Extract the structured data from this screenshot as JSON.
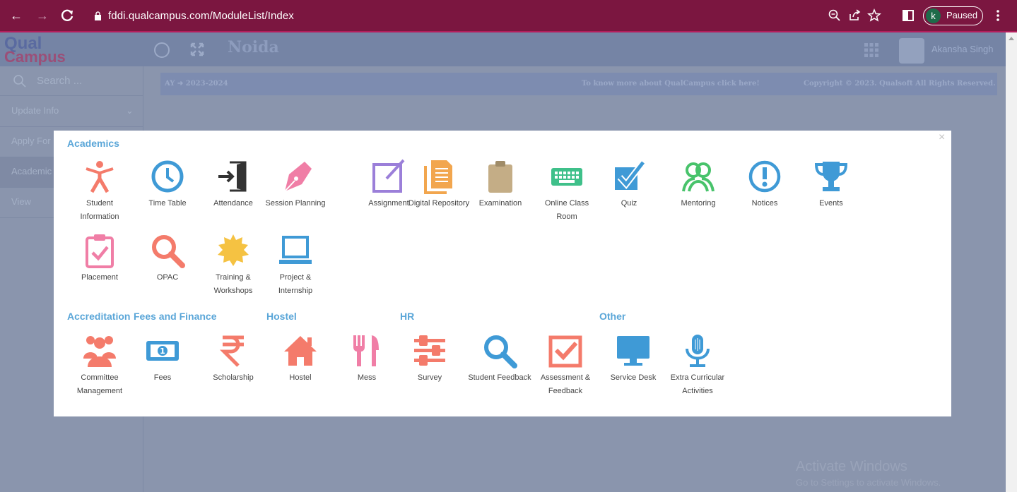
{
  "browser": {
    "url": "fddi.qualcampus.com/ModuleList/Index",
    "profile_initial": "k",
    "profile_status": "Paused"
  },
  "app": {
    "logo_top": "Qual",
    "logo_bottom": "Campus",
    "location": "Noida",
    "user_name": "Akansha Singh",
    "search_placeholder": "Search ...",
    "sidebar": [
      "Update Info",
      "Apply For",
      "Academic",
      "View"
    ],
    "ay_text": "AY ➜ 2023-2024",
    "know_more": "To know more about QualCampus click here!",
    "copyright": "Copyright © 2023. Qualsoft All Rights Reserved."
  },
  "watermark": {
    "title": "Activate Windows",
    "subtitle": "Go to Settings to activate Windows."
  },
  "modal": {
    "close": "×",
    "sections": {
      "academics": "Academics",
      "accreditation": "Accreditation",
      "fees": "Fees and Finance",
      "hostel": "Hostel",
      "hr": "HR",
      "other": "Other"
    },
    "academics": [
      {
        "label": "Student Information",
        "icon": "student-icon",
        "color": "#f47b6b"
      },
      {
        "label": "Time Table",
        "icon": "clock-icon",
        "color": "#3f9ad6"
      },
      {
        "label": "Attendance",
        "icon": "door-icon",
        "color": "#333333"
      },
      {
        "label": "Session Planning",
        "icon": "pen-icon",
        "color": "#f07ea6"
      },
      {
        "label": "Assignment",
        "icon": "edit-icon",
        "color": "#9b7fd9"
      },
      {
        "label": "Digital Repository",
        "icon": "documents-icon",
        "color": "#f2a64e"
      },
      {
        "label": "Examination",
        "icon": "clipboard-icon",
        "color": "#c4ad86"
      },
      {
        "label": "Online Class Room",
        "icon": "keyboard-icon",
        "color": "#3fc08a"
      },
      {
        "label": "Quiz",
        "icon": "checkbox-icon",
        "color": "#3f9ad6"
      },
      {
        "label": "Mentoring",
        "icon": "people-icon",
        "color": "#48c36b"
      },
      {
        "label": "Notices",
        "icon": "exclamation-icon",
        "color": "#3f9ad6"
      },
      {
        "label": "Events",
        "icon": "trophy-icon",
        "color": "#3f9ad6"
      },
      {
        "label": "Placement",
        "icon": "clipboard-check-icon",
        "color": "#f07ea6"
      },
      {
        "label": "OPAC",
        "icon": "search-icon",
        "color": "#f47b6b"
      },
      {
        "label": "Training & Workshops",
        "icon": "sun-icon",
        "color": "#f5c242"
      },
      {
        "label": "Project & Internship",
        "icon": "laptop-icon",
        "color": "#3f9ad6"
      }
    ],
    "lower": [
      {
        "label": "Committee Management",
        "icon": "group-icon",
        "color": "#f47b6b"
      },
      {
        "label": "Fees",
        "icon": "money-icon",
        "color": "#3f9ad6"
      },
      {
        "label": "Scholarship",
        "icon": "rupee-icon",
        "color": "#f47b6b"
      },
      {
        "label": "Hostel",
        "icon": "home-icon",
        "color": "#f47b6b"
      },
      {
        "label": "Mess",
        "icon": "cutlery-icon",
        "color": "#f07ea6"
      },
      {
        "label": "Survey",
        "icon": "sliders-icon",
        "color": "#f47b6b"
      },
      {
        "label": "Student Feedback",
        "icon": "search-icon",
        "color": "#3f9ad6"
      },
      {
        "label": "Assessment & Feedback",
        "icon": "check-square-icon",
        "color": "#f47b6b"
      },
      {
        "label": "Service Desk",
        "icon": "monitor-icon",
        "color": "#3f9ad6"
      },
      {
        "label": "Extra Curricular Activities",
        "icon": "microphone-icon",
        "color": "#3f9ad6"
      }
    ]
  }
}
